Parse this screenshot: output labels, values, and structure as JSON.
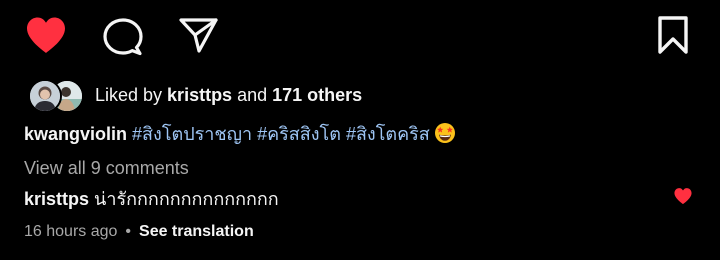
{
  "actions": {
    "like_icon": "heart-filled",
    "comment_icon": "speech-bubble",
    "share_icon": "paper-plane",
    "save_icon": "bookmark",
    "like_color": "#ff3040"
  },
  "likes": {
    "prefix": "Liked by ",
    "user": "kristtps",
    "conjunction": " and ",
    "others": "171 others"
  },
  "caption": {
    "user": "kwangviolin",
    "hashtags": [
      "#สิงโตปราชญา",
      "#คริสสิงโต",
      "#สิงโตคริส"
    ],
    "emoji": "star-struck-emoji"
  },
  "comments": {
    "view_all": "View all 9 comments",
    "top": {
      "user": "kristtps",
      "text": "น่ารักกกกกกกกกกกกกก",
      "liked": true
    }
  },
  "meta": {
    "time": "16 hours ago",
    "separator": "•",
    "translate": "See translation"
  },
  "colors": {
    "background": "#000000",
    "text": "#f5f5f5",
    "muted": "#a8a8a8",
    "hashtag": "#9fc6f5",
    "like": "#ff3040"
  }
}
